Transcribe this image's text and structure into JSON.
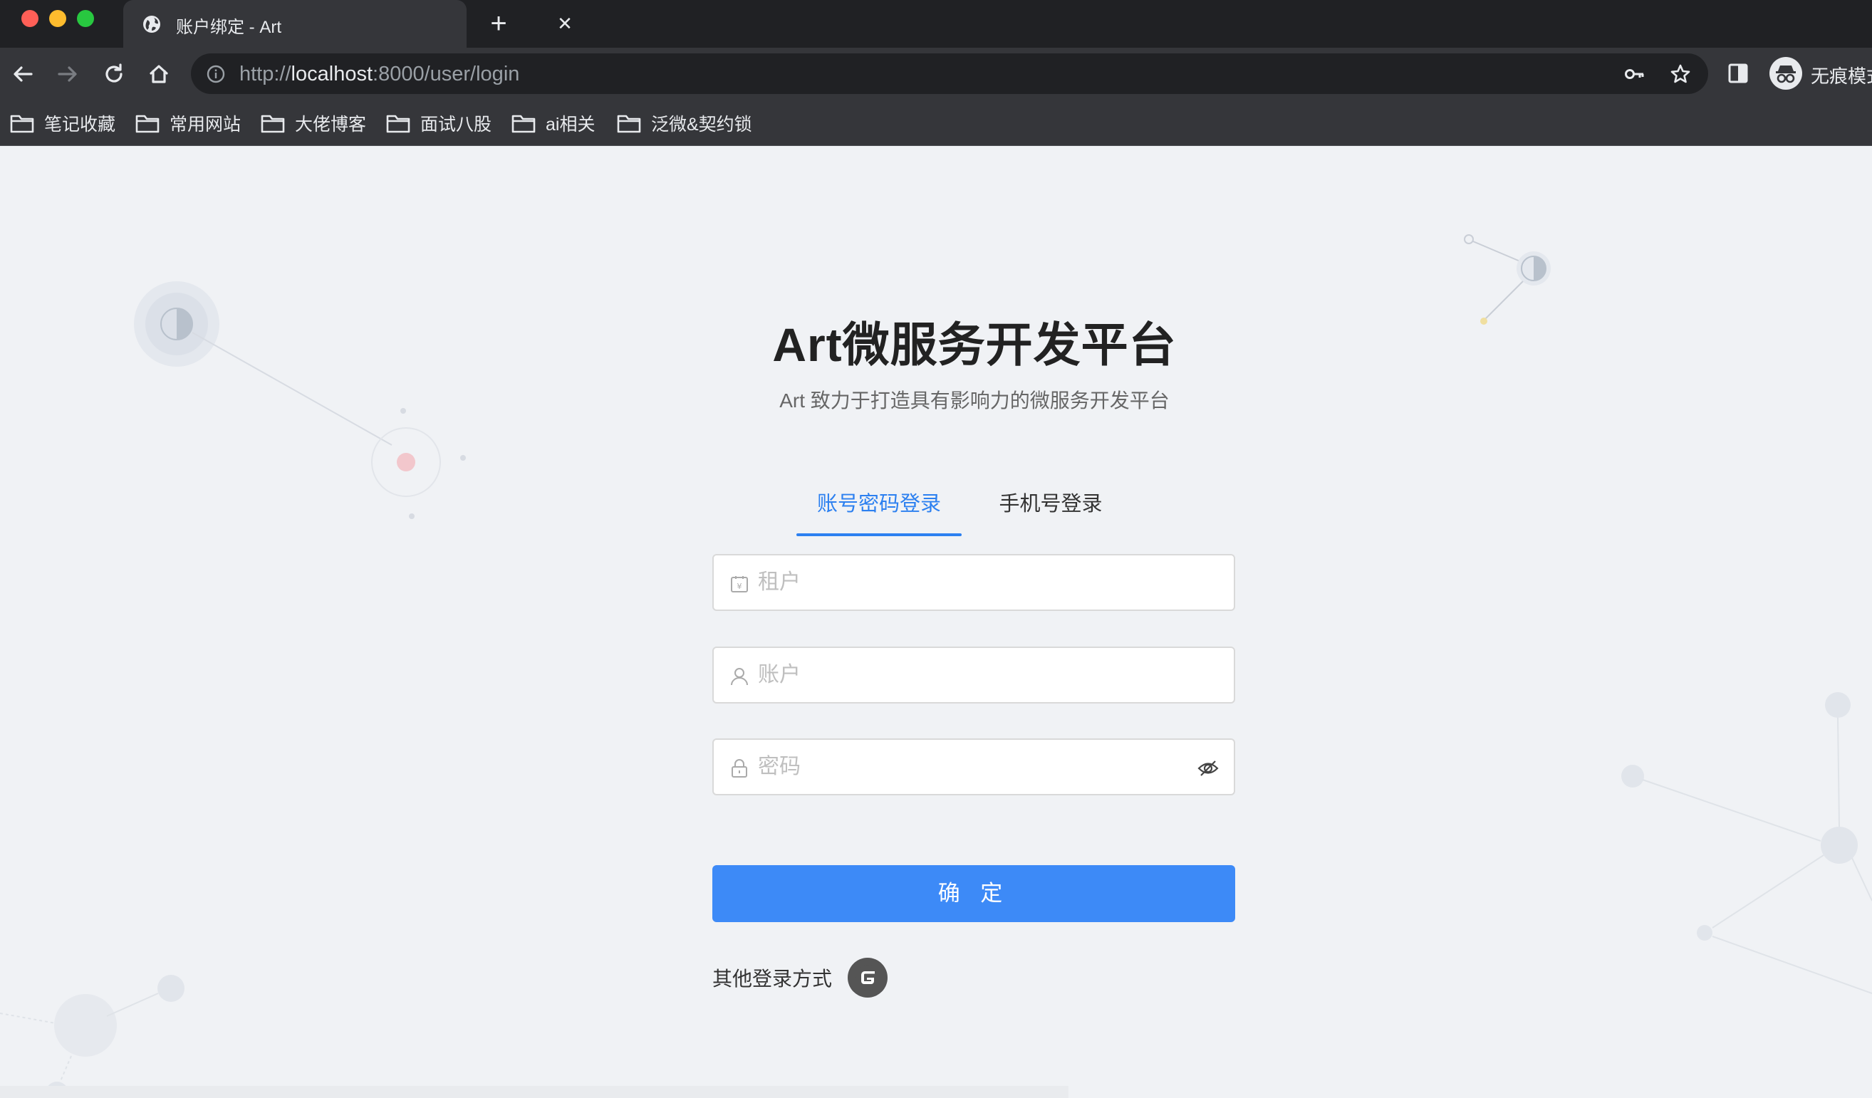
{
  "browser": {
    "tab_title": "账户绑定 - Art",
    "tab_close": "✕",
    "new_tab": "+",
    "url_scheme": "http://",
    "url_host": "localhost",
    "url_rest": ":8000/user/login",
    "profile_label": "无痕模式",
    "bookmarks": [
      {
        "label": "笔记收藏"
      },
      {
        "label": "常用网站"
      },
      {
        "label": "大佬博客"
      },
      {
        "label": "面试八股"
      },
      {
        "label": "ai相关"
      },
      {
        "label": "泛微&契约锁"
      }
    ]
  },
  "login": {
    "title": "Art微服务开发平台",
    "subtitle": "Art 致力于打造具有影响力的微服务开发平台",
    "tabs": {
      "account": "账号密码登录",
      "phone": "手机号登录"
    },
    "fields": {
      "tenant_placeholder": "租户",
      "account_placeholder": "账户",
      "password_placeholder": "密码"
    },
    "submit_label": "确 定",
    "other_login_label": "其他登录方式"
  },
  "colors": {
    "primary": "#3d8af7",
    "active_tab": "#2c80f0",
    "page_bg": "#f0f2f5",
    "chrome_bg": "#202124"
  }
}
